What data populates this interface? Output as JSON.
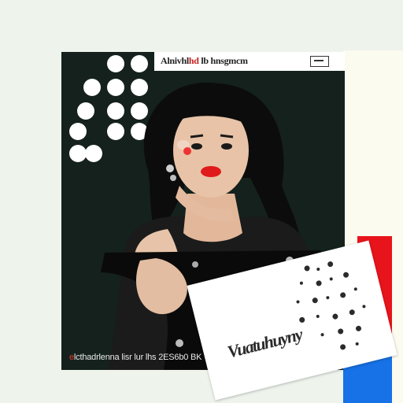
{
  "poster": {
    "header_text_a": "Alnivhl",
    "header_text_red": "hd",
    "header_text_b": "lb hnsgmcm",
    "footer_mark": "e",
    "footer_text": "lcthadrlenna lisr lur  lhs 2ES6b0 BK"
  },
  "card": {
    "word": "Vuatuhuyny"
  },
  "colors": {
    "background": "#eef3ec",
    "poster_bg": "#14211d",
    "accent_red": "#e8141b",
    "accent_blue": "#1672e6",
    "cream": "#fbfbef"
  }
}
